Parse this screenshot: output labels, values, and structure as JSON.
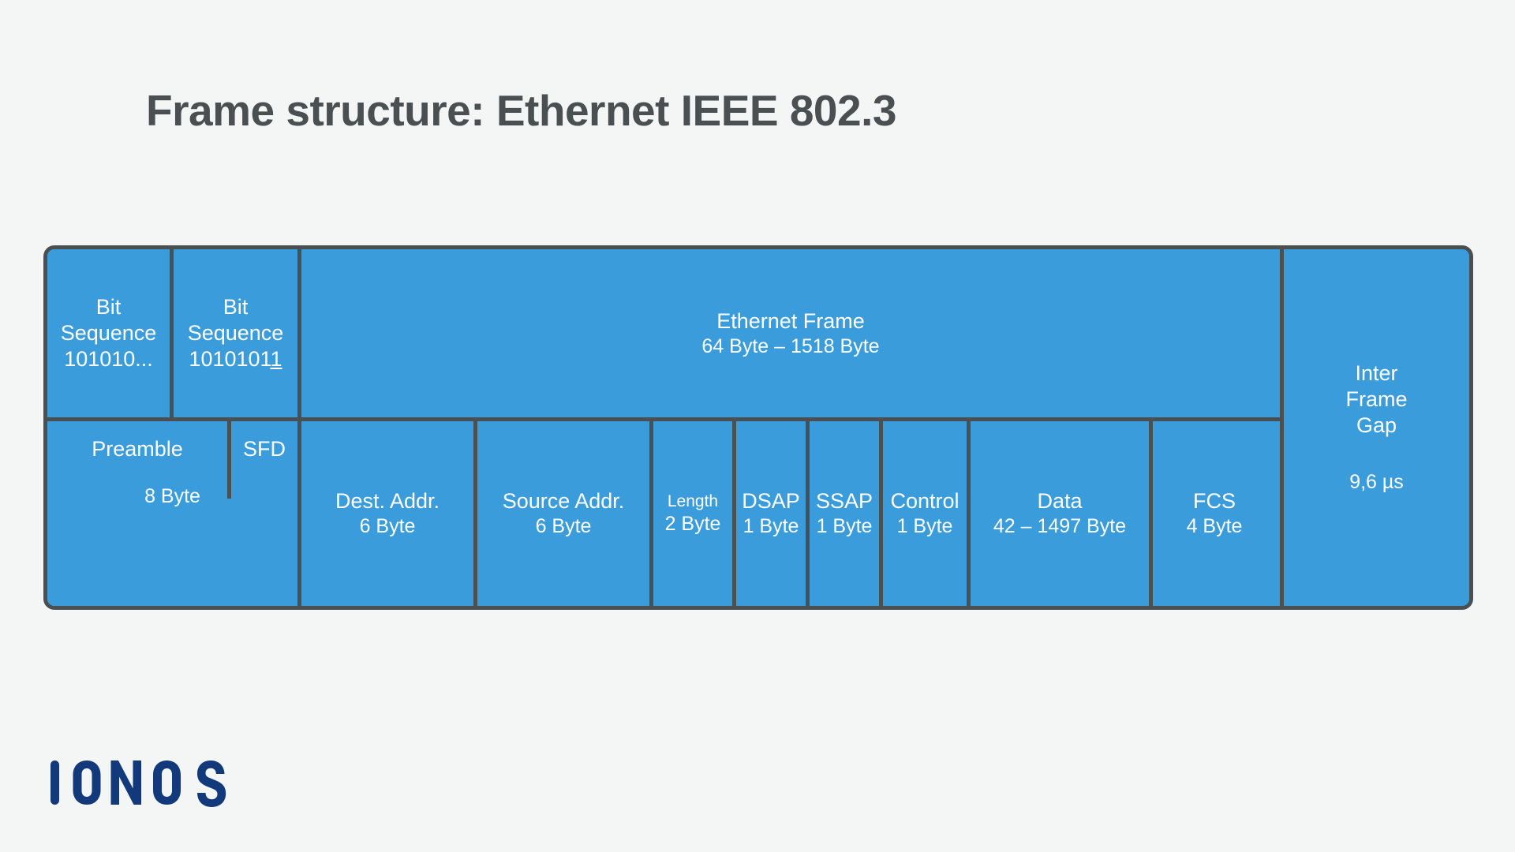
{
  "page": {
    "title": "Frame structure: Ethernet IEEE 802.3",
    "background_color": "#f4f5f5",
    "accent_color": "#3b9cdb",
    "outline_color": "#4a4f52",
    "brand_color": "#123a7a"
  },
  "brand": {
    "name": "IONOS"
  },
  "diagram": {
    "type": "frame-structure",
    "top_row": [
      {
        "id": "bit-sequence-1",
        "lines": [
          "Bit",
          "Sequence",
          "101010..."
        ],
        "label": "Bit Sequence",
        "value": "101010...",
        "underline_suffix": ""
      },
      {
        "id": "bit-sequence-2",
        "lines": [
          "Bit",
          "Sequence",
          "10101011"
        ],
        "label": "Bit Sequence",
        "value": "1010101",
        "underline_suffix": "1"
      },
      {
        "id": "ethernet-frame",
        "label": "Ethernet Frame",
        "size": "64 Byte – 1518 Byte"
      }
    ],
    "inter_frame_gap": {
      "id": "inter-frame-gap",
      "line1": "Inter",
      "line2": "Frame",
      "line3": "Gap",
      "duration": "9,6 µs"
    },
    "bottom_row": [
      {
        "id": "preamble",
        "label": "Preamble",
        "sub_label": "SFD",
        "size": "8 Byte"
      },
      {
        "id": "dest-addr",
        "label": "Dest. Addr.",
        "size": "6 Byte"
      },
      {
        "id": "source-addr",
        "label": "Source Addr.",
        "size": "6 Byte"
      },
      {
        "id": "length",
        "label": "Length",
        "size": "2 Byte"
      },
      {
        "id": "dsap",
        "label": "DSAP",
        "size": "1 Byte"
      },
      {
        "id": "ssap",
        "label": "SSAP",
        "size": "1 Byte"
      },
      {
        "id": "control",
        "label": "Control",
        "size": "1 Byte"
      },
      {
        "id": "data",
        "label": "Data",
        "size": "42 – 1497 Byte"
      },
      {
        "id": "fcs",
        "label": "FCS",
        "size": "4 Byte"
      }
    ]
  }
}
